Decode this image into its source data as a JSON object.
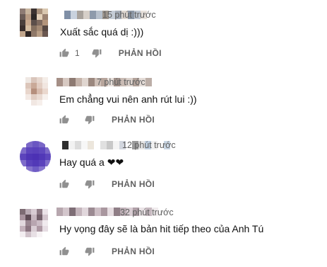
{
  "reply_label": "PHẢN HỒI",
  "comments": [
    {
      "time": "15 phút trước",
      "text": "Xuất sắc quá dị :)))",
      "likes": "1",
      "avatar_colors": [
        "#8d7b74",
        "#c7b49e",
        "#3c3331",
        "#a8917c",
        "#d9c7b0",
        "#6a5c57",
        "#b89c85",
        "#2d2826",
        "#e3d0b8",
        "#9a8271",
        "#4b403c",
        "#c9a98e",
        "#5c4f4a",
        "#7f6a5e",
        "#b3947b",
        "#3a2f2c",
        "#d6bea2",
        "#86705f",
        "#a48a74",
        "#574842",
        "#c2a68c",
        "#2e2523",
        "#8f7868",
        "#b89e86",
        "#6b5850"
      ],
      "name_colors": [
        "#7f8fa6",
        "#c9d2de",
        "#a8a29c",
        "#d6cfc8",
        "#8e9aab",
        "#b7c0cc",
        "#9c948c",
        "#c4ccd6",
        "#a5adb8",
        "#ddd6cf",
        "#8c97a5",
        "#bfc7d1",
        "#e6e0da"
      ]
    },
    {
      "time": "7 phút trước",
      "text": "Em chẳng vui nên anh rút lui :))",
      "likes": "",
      "avatar_colors": [
        "#efe8e3",
        "#d9c5bb",
        "#e7d8cf",
        "#f4ede8",
        "#ffffff",
        "#dcc6ba",
        "#c9a998",
        "#e2cdc2",
        "#f1e6e0",
        "#ffffff",
        "#e8d6cc",
        "#b58f7d",
        "#d8bcae",
        "#ead8ce",
        "#ffffff",
        "#f3e9e4",
        "#e0cdc3",
        "#eadbd3",
        "#f7f1ed",
        "#ffffff",
        "#ffffff",
        "#f1e7e2",
        "#f6efeb",
        "#ffffff",
        "#ffffff"
      ],
      "name_colors": [
        "#a58f86",
        "#d7c9c2",
        "#8d7a72",
        "#c4b3aa",
        "#e0d6d0",
        "#9b887f",
        "#cfc0b8",
        "#b7a59c",
        "#e8e0db",
        "#a09089",
        "#c9bbb4",
        "#dcd2cc",
        "#b2a29a",
        "#e4dcd7",
        "#bcaea7"
      ]
    },
    {
      "time": "12 phút trước",
      "text": "Hay quá a ❤❤",
      "likes": "",
      "avatar_colors": [
        "#ffffff",
        "#7b68c8",
        "#6a56c2",
        "#7a67c7",
        "#ffffff",
        "#7d6ac9",
        "#5d45bd",
        "#5a41bb",
        "#5f48be",
        "#7c69c8",
        "#5c44bc",
        "#4f35b6",
        "#4c31b4",
        "#5138b7",
        "#5d46bd",
        "#7e6cca",
        "#5a42bb",
        "#5239b7",
        "#5b43bc",
        "#7f6dca",
        "#ffffff",
        "#8574cd",
        "#6f5cc5",
        "#8675ce",
        "#ffffff"
      ],
      "name_colors": [
        "#2e2e2e",
        "#f2f2f2",
        "#dcdcdc",
        "#f7f7f7",
        "#ece6dc",
        "#ffffff",
        "#e0e0e0",
        "#c8c8c8",
        "#f4f4f4",
        "#d2d6de",
        "#ffffff",
        "#9a9a9a",
        "#e6e6e6",
        "#bfcfe0",
        "#f0f0f0",
        "#ffffff",
        "#c9d6e3"
      ]
    },
    {
      "time": "32 phút trước",
      "text": "Hy vọng đây sẽ là bản hit tiếp theo của Anh Tú",
      "likes": "",
      "avatar_colors": [
        "#7d6b73",
        "#b9aab3",
        "#d8ccd3",
        "#8e7a84",
        "#ebe3e8",
        "#a8939e",
        "#5e4b55",
        "#c6b6bf",
        "#73606a",
        "#d3c5cd",
        "#e2d8de",
        "#9a8691",
        "#b8a6b0",
        "#cbbcc5",
        "#f0eaee",
        "#c4b2bc",
        "#8a7480",
        "#d9cdd4",
        "#ad98a3",
        "#e6dde3",
        "#f3eef1",
        "#d0c2ca",
        "#e8e0e5",
        "#f7f3f5",
        "#ffffff"
      ],
      "name_colors": [
        "#b7a7ae",
        "#d3c6cc",
        "#7e6e76",
        "#c4b5bc",
        "#e1d7dc",
        "#9b8a92",
        "#cdbec5",
        "#a9979f",
        "#e6dde1",
        "#8f7e86",
        "#bfb0b7",
        "#d9cdd3",
        "#b0a0a8",
        "#eae3e6",
        "#c7b9c0",
        "#f1ecee"
      ]
    }
  ]
}
